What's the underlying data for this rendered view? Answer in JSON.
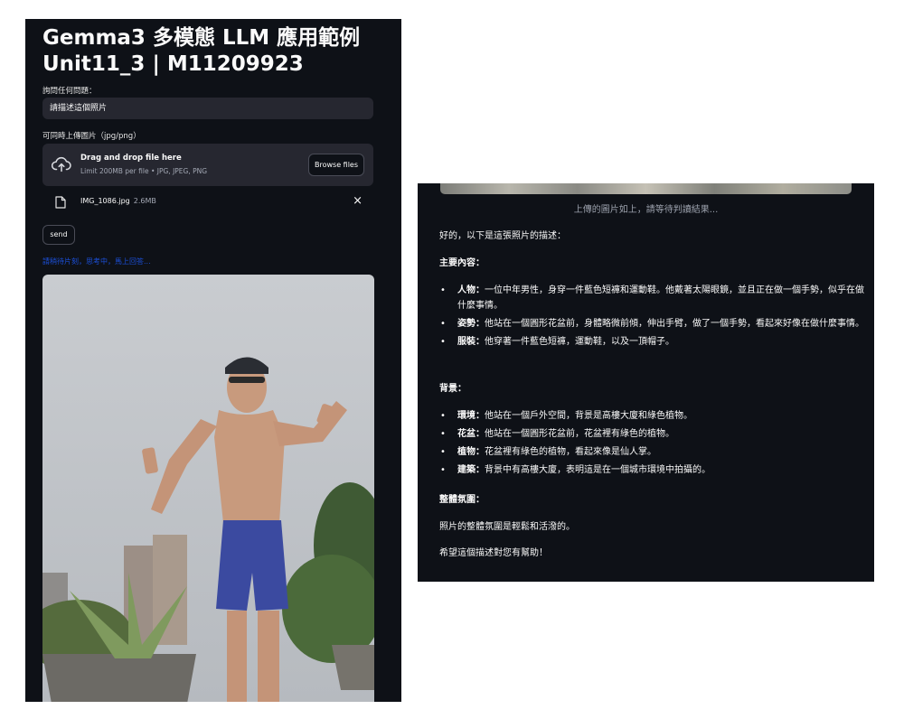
{
  "app": {
    "title_line1": "Gemma3 多模態 LLM 應用範例",
    "title_line2": "Unit11_3 | M11209923"
  },
  "query": {
    "label": "詢問任何問題：",
    "value": "請描述這個照片"
  },
  "upload": {
    "label": "可同時上傳圖片（jpg/png）",
    "drop_text": "Drag and drop file here",
    "limit_text": "Limit 200MB per file • JPG, JPEG, PNG",
    "browse_label": "Browse files",
    "icon": "cloud-upload-icon"
  },
  "file": {
    "name": "IMG_1086.jpg",
    "size": "2.6MB",
    "icon": "file-icon",
    "close": "×"
  },
  "send": {
    "label": "send"
  },
  "status": {
    "text": "請稍待片刻，思考中，馬上回答..."
  },
  "response": {
    "caption": "上傳的圖片如上，請等待判讀結果...",
    "intro": "好的，以下是這張照片的描述：",
    "main_heading": "主要內容：",
    "main_items": [
      {
        "head": "人物：",
        "text": "一位中年男性，身穿一件藍色短褲和運動鞋。他戴著太陽眼鏡，並且正在做一個手勢，似乎在做什麼事情。"
      },
      {
        "head": "姿勢：",
        "text": "他站在一個圓形花盆前，身體略微前傾，伸出手臂，做了一個手勢，看起來好像在做什麼事情。"
      },
      {
        "head": "服裝：",
        "text": "他穿著一件藍色短褲，運動鞋，以及一頂帽子。"
      }
    ],
    "bg_heading": "背景：",
    "bg_items": [
      {
        "head": "環境：",
        "text": "他站在一個戶外空間，背景是高樓大廈和綠色植物。"
      },
      {
        "head": "花盆：",
        "text": "他站在一個圓形花盆前，花盆裡有綠色的植物。"
      },
      {
        "head": "植物：",
        "text": "花盆裡有綠色的植物，看起來像是仙人掌。"
      },
      {
        "head": "建築：",
        "text": "背景中有高樓大廈，表明這是在一個城市環境中拍攝的。"
      }
    ],
    "mood_heading": "整體氛圍：",
    "mood_text": "照片的整體氛圍是輕鬆和活潑的。",
    "closing": "希望這個描述對您有幫助！"
  },
  "colors": {
    "background": "#0e1117",
    "input_bg": "#262730",
    "status_text": "#1b4fd8",
    "shorts": "#3b4aa0"
  }
}
